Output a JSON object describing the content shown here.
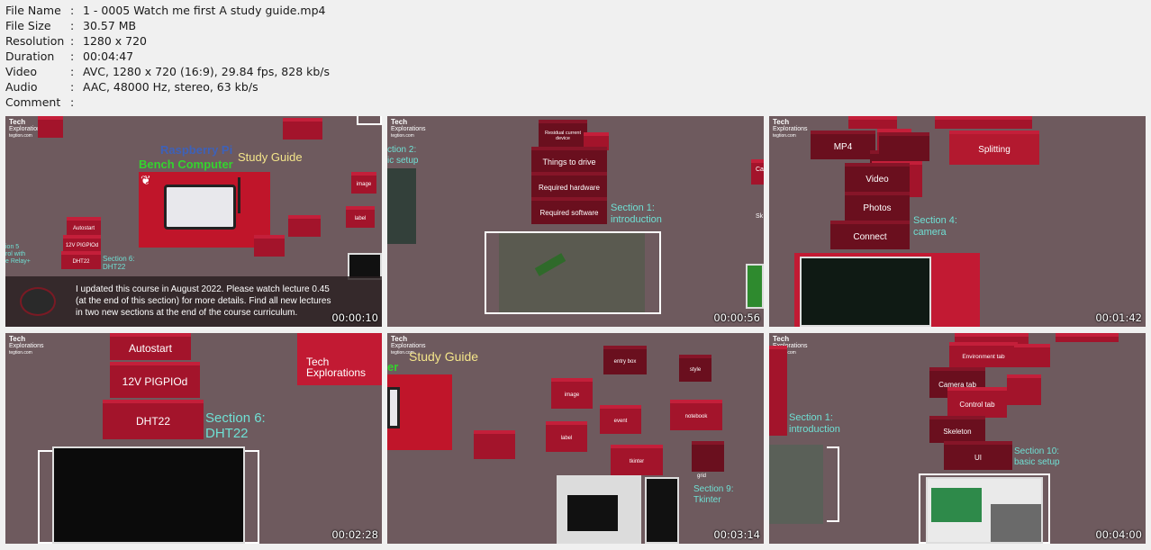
{
  "file_info": [
    {
      "key": "File Name",
      "value": "1 - 0005 Watch me first A study guide.mp4"
    },
    {
      "key": "File Size",
      "value": "30.57 MB"
    },
    {
      "key": "Resolution",
      "value": "1280 x 720"
    },
    {
      "key": "Duration",
      "value": "00:04:47"
    },
    {
      "key": "Video",
      "value": "AVC, 1280 x 720 (16:9), 29.84 fps, 828 kb/s"
    },
    {
      "key": "Audio",
      "value": "AAC, 48000 Hz, stereo, 63 kb/s"
    },
    {
      "key": "Comment",
      "value": ""
    }
  ],
  "separator": ":",
  "logo": {
    "line1": "Tech",
    "line2": "Explorations",
    "line3": "tegtion.com"
  },
  "thumbnails": [
    {
      "timestamp": "00:00:10",
      "title_a": "Raspberry Pi",
      "title_b": "Bench Computer",
      "title_c": "Study Guide",
      "bricks": [
        "Autostart",
        "12V PIGPIOd",
        "DHT22",
        "image",
        "label"
      ],
      "sections": [
        "Section 6:",
        "DHT22",
        "ion 5",
        "rol with",
        "e Relay+"
      ],
      "caption": "I updated this course in August 2022. Please watch lecture 0.45 (at the end of this section) for more details. Find all new lectures in two new sections at the end of the course curriculum."
    },
    {
      "timestamp": "00:00:56",
      "bricks": [
        "Residual current device",
        "Things to drive",
        "Required hardware",
        "Required software"
      ],
      "sections": [
        "Section 1:",
        "introduction",
        "ction 2:",
        "ic setup"
      ],
      "edge": [
        "Ca",
        "Sk"
      ]
    },
    {
      "timestamp": "00:01:42",
      "bricks": [
        "MP4",
        "Splitting",
        "Video",
        "Photos",
        "Connect"
      ],
      "sections": [
        "Section 4:",
        "camera"
      ]
    },
    {
      "timestamp": "00:02:28",
      "bricks": [
        "Autostart",
        "12V PIGPIOd",
        "DHT22"
      ],
      "sections": [
        "Section 6:",
        "DHT22"
      ]
    },
    {
      "timestamp": "00:03:14",
      "title": "Study Guide",
      "title_edge": "er",
      "bricks": [
        "entry box",
        "style",
        "image",
        "event",
        "notebook",
        "label",
        "tkinter",
        "grid"
      ],
      "sections": [
        "Section 9:",
        "Tkinter"
      ]
    },
    {
      "timestamp": "00:04:00",
      "bricks": [
        "Environment tab",
        "Camera tab",
        "Control tab",
        "Skeleton",
        "UI"
      ],
      "sections": [
        "Section 1:",
        "introduction",
        "Section 10:",
        "basic setup"
      ]
    }
  ]
}
